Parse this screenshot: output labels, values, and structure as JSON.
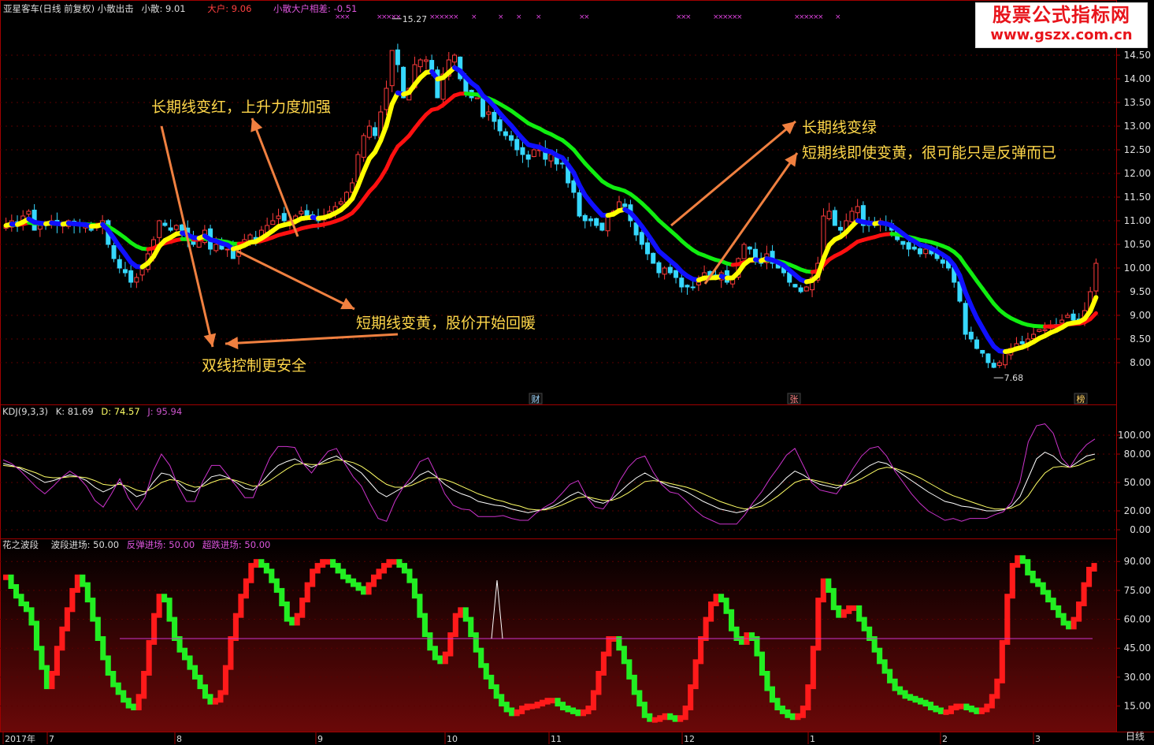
{
  "colors": {
    "bg": "#000000",
    "axis": "#a00000",
    "grid": "#5a0000",
    "up": "#ff3b3b",
    "down": "#36d8ff",
    "yellow": "#ffff00",
    "red": "#ff1010",
    "blue": "#1010ff",
    "green": "#10ee10",
    "kdj_k": "#ffffff",
    "kdj_d": "#ffff66",
    "kdj_j": "#cc33cc",
    "ref_line": "#cc33cc"
  },
  "header": {
    "title": "亚星客车(日线 前复权) 小散出击",
    "small_label": "小散: 9.01",
    "big_label": "大户: 9.06",
    "diff_label": "小散大户相差: -0.51"
  },
  "kdj_header": {
    "name": "KDJ(9,3,3)",
    "k": "K: 81.69",
    "d": "D: 74.57",
    "j": "J: 95.94"
  },
  "wave_header": {
    "name": "花之波段",
    "wave": "波段进场: 50.00",
    "rebound": "反弹进场: 50.00",
    "oversold": "超跌进场: 50.00"
  },
  "watermark": {
    "line1": "股票公式指标网",
    "line2": "www.gszx.com.cn"
  },
  "timeframe_label": "日线",
  "annotations": {
    "a1": "长期线变红，上升力度加强",
    "a2": "长期线变绿",
    "a3": "短期线即使变黄，很可能只是反弹而已",
    "a4": "短期线变黄，股价开始回暖",
    "a5": "双线控制更安全"
  },
  "chart_data": [
    {
      "type": "candlestick",
      "ylim": [
        7.5,
        15.0
      ],
      "y_ticks": [
        "14.50",
        "14.00",
        "13.50",
        "13.00",
        "12.50",
        "12.00",
        "11.50",
        "11.00",
        "10.50",
        "10.00",
        "9.50",
        "9.00",
        "8.50",
        "8.00"
      ],
      "x_ticks": [
        "2017年",
        "7",
        "8",
        "9",
        "10",
        "11",
        "12",
        "1",
        "2",
        "3"
      ],
      "close": [
        10.9,
        11.0,
        10.9,
        11.1,
        11.2,
        10.8,
        10.9,
        10.9,
        11.0,
        10.9,
        10.9,
        11.0,
        10.9,
        10.9,
        10.9,
        10.8,
        10.9,
        11.0,
        10.5,
        10.2,
        10.0,
        9.9,
        9.7,
        9.8,
        10.0,
        10.3,
        10.6,
        11.0,
        10.9,
        10.8,
        10.9,
        10.8,
        10.6,
        10.5,
        10.6,
        10.8,
        10.4,
        10.5,
        10.4,
        10.4,
        10.2,
        10.5,
        10.6,
        10.7,
        10.6,
        10.8,
        10.9,
        11.0,
        11.1,
        11.0,
        11.0,
        11.1,
        11.2,
        11.1,
        11.1,
        11.0,
        11.1,
        11.2,
        11.3,
        11.4,
        11.6,
        11.8,
        12.4,
        12.8,
        13.0,
        12.8,
        13.3,
        13.8,
        14.6,
        14.3,
        13.6,
        13.8,
        14.3,
        14.4,
        14.4,
        14.2,
        13.6,
        14.1,
        14.4,
        14.5,
        14.0,
        13.7,
        13.6,
        13.6,
        13.2,
        13.3,
        13.1,
        12.9,
        12.8,
        12.7,
        12.5,
        12.4,
        12.3,
        12.5,
        12.5,
        12.3,
        12.4,
        12.2,
        12.2,
        11.8,
        11.6,
        11.1,
        11.0,
        11.0,
        10.9,
        10.8,
        11.1,
        11.2,
        11.4,
        11.3,
        11.0,
        10.7,
        10.5,
        10.3,
        10.1,
        9.9,
        10.0,
        9.9,
        9.8,
        9.6,
        9.6,
        9.6,
        9.7,
        9.9,
        9.8,
        9.8,
        9.9,
        9.7,
        9.8,
        10.2,
        10.5,
        10.4,
        10.2,
        10.1,
        10.3,
        10.1,
        10.0,
        9.9,
        9.7,
        9.6,
        9.5,
        9.6,
        9.8,
        10.1,
        11.1,
        11.2,
        10.9,
        10.8,
        11.0,
        11.2,
        11.3,
        10.9,
        10.9,
        10.9,
        11.0,
        10.9,
        10.8,
        10.6,
        10.5,
        10.4,
        10.4,
        10.3,
        10.4,
        10.3,
        10.2,
        10.1,
        10.0,
        9.7,
        9.3,
        8.6,
        8.5,
        8.3,
        8.2,
        8.0,
        7.9,
        8.0,
        8.2,
        8.3,
        8.4,
        8.4,
        8.5,
        8.6,
        8.7,
        8.7,
        8.8,
        8.8,
        8.9,
        9.0,
        8.9,
        8.9,
        9.1,
        9.5,
        10.1
      ],
      "low_point": {
        "value": 7.68,
        "label": "7.68"
      },
      "high_point": {
        "value": 15.27,
        "label": "15.27"
      },
      "event_tags": [
        "财",
        "张",
        "榜"
      ]
    },
    {
      "type": "line",
      "name": "KDJ(9,3,3)",
      "ylim": [
        -5,
        110
      ],
      "y_ticks": [
        "100.00",
        "80.00",
        "50.00",
        "20.00",
        "0.00"
      ],
      "series": [
        {
          "name": "K",
          "values": [
            70,
            68,
            65,
            60,
            55,
            50,
            52,
            55,
            58,
            56,
            52,
            45,
            40,
            44,
            50,
            42,
            35,
            38,
            50,
            60,
            58,
            50,
            42,
            40,
            48,
            56,
            58,
            55,
            50,
            44,
            42,
            50,
            60,
            68,
            72,
            75,
            70,
            66,
            70,
            75,
            78,
            72,
            66,
            60,
            50,
            40,
            35,
            40,
            45,
            50,
            58,
            62,
            56,
            48,
            42,
            38,
            35,
            30,
            28,
            26,
            25,
            22,
            20,
            18,
            20,
            22,
            25,
            30,
            36,
            40,
            35,
            30,
            28,
            32,
            40,
            48,
            55,
            60,
            55,
            50,
            46,
            44,
            40,
            35,
            30,
            26,
            22,
            20,
            18,
            20,
            25,
            30,
            38,
            46,
            55,
            62,
            58,
            52,
            48,
            46,
            44,
            48,
            55,
            62,
            68,
            72,
            70,
            64,
            58,
            52,
            46,
            40,
            35,
            30,
            28,
            25,
            24,
            22,
            20,
            20,
            21,
            25,
            35,
            55,
            75,
            82,
            78,
            70,
            66,
            72,
            78,
            80
          ]
        },
        {
          "name": "D",
          "values": [
            68,
            67,
            66,
            63,
            60,
            56,
            55,
            55,
            56,
            56,
            55,
            52,
            48,
            47,
            48,
            46,
            42,
            40,
            44,
            50,
            53,
            52,
            48,
            45,
            46,
            50,
            53,
            54,
            52,
            49,
            46,
            47,
            52,
            58,
            64,
            69,
            70,
            69,
            69,
            71,
            74,
            73,
            71,
            67,
            61,
            54,
            48,
            45,
            45,
            47,
            51,
            55,
            55,
            53,
            50,
            46,
            42,
            38,
            35,
            32,
            30,
            27,
            25,
            22,
            21,
            21,
            23,
            26,
            30,
            34,
            35,
            33,
            31,
            31,
            34,
            39,
            45,
            51,
            52,
            51,
            49,
            47,
            45,
            42,
            38,
            34,
            30,
            27,
            24,
            22,
            23,
            25,
            30,
            36,
            43,
            50,
            53,
            53,
            51,
            49,
            47,
            47,
            50,
            54,
            59,
            64,
            66,
            65,
            62,
            59,
            55,
            50,
            45,
            40,
            36,
            33,
            30,
            27,
            24,
            22,
            22,
            23,
            27,
            36,
            49,
            60,
            66,
            67,
            66,
            68,
            72,
            75
          ]
        },
        {
          "name": "J",
          "values": [
            74,
            70,
            63,
            54,
            45,
            38,
            46,
            55,
            62,
            56,
            46,
            31,
            24,
            38,
            54,
            34,
            21,
            34,
            62,
            80,
            68,
            46,
            30,
            30,
            52,
            68,
            68,
            57,
            46,
            34,
            34,
            56,
            76,
            88,
            88,
            87,
            70,
            60,
            72,
            83,
            86,
            70,
            56,
            46,
            28,
            12,
            9,
            30,
            45,
            56,
            72,
            76,
            58,
            38,
            26,
            22,
            21,
            14,
            14,
            14,
            15,
            12,
            10,
            10,
            18,
            24,
            29,
            38,
            48,
            52,
            35,
            24,
            22,
            34,
            52,
            66,
            75,
            78,
            61,
            48,
            40,
            38,
            30,
            21,
            14,
            10,
            6,
            6,
            6,
            16,
            29,
            40,
            54,
            66,
            79,
            86,
            68,
            50,
            42,
            40,
            38,
            50,
            65,
            78,
            86,
            88,
            78,
            62,
            50,
            38,
            28,
            20,
            15,
            10,
            12,
            9,
            12,
            12,
            12,
            16,
            19,
            29,
            51,
            93,
            110,
            112,
            102,
            76,
            66,
            80,
            90,
            96
          ]
        }
      ]
    },
    {
      "type": "bar",
      "name": "花之波段",
      "ylim": [
        5,
        95
      ],
      "y_ticks": [
        "90.00",
        "75.00",
        "60.00",
        "45.00",
        "30.00",
        "15.00"
      ],
      "reference_line": 50,
      "values": [
        82,
        77,
        72,
        68,
        65,
        58,
        45,
        35,
        25,
        32,
        45,
        55,
        65,
        75,
        82,
        78,
        70,
        60,
        50,
        40,
        32,
        26,
        22,
        18,
        15,
        14,
        20,
        32,
        48,
        62,
        72,
        70,
        60,
        50,
        44,
        40,
        35,
        30,
        25,
        20,
        17,
        18,
        22,
        35,
        50,
        62,
        72,
        80,
        88,
        90,
        88,
        85,
        80,
        75,
        68,
        60,
        58,
        62,
        70,
        78,
        85,
        88,
        90,
        90,
        88,
        85,
        82,
        80,
        78,
        76,
        74,
        78,
        82,
        85,
        88,
        90,
        90,
        88,
        85,
        80,
        72,
        62,
        52,
        45,
        40,
        38,
        42,
        52,
        62,
        65,
        60,
        52,
        44,
        36,
        30,
        25,
        20,
        16,
        13,
        11,
        12,
        14,
        15,
        15,
        16,
        17,
        18,
        18,
        16,
        14,
        13,
        12,
        11,
        12,
        14,
        22,
        32,
        42,
        50,
        50,
        45,
        38,
        30,
        22,
        16,
        10,
        8,
        8,
        9,
        10,
        9,
        8,
        9,
        14,
        25,
        38,
        50,
        60,
        68,
        72,
        70,
        64,
        55,
        50,
        48,
        52,
        50,
        42,
        32,
        24,
        18,
        14,
        12,
        10,
        9,
        10,
        14,
        25,
        45,
        70,
        80,
        75,
        66,
        62,
        64,
        66,
        66,
        60,
        55,
        50,
        44,
        38,
        33,
        28,
        24,
        22,
        20,
        19,
        18,
        17,
        16,
        14,
        13,
        12,
        12,
        14,
        15,
        15,
        14,
        13,
        12,
        13,
        15,
        20,
        28,
        48,
        72,
        88,
        92,
        90,
        84,
        80,
        78,
        74,
        70,
        66,
        62,
        58,
        56,
        60,
        68,
        78,
        86,
        88
      ]
    }
  ]
}
